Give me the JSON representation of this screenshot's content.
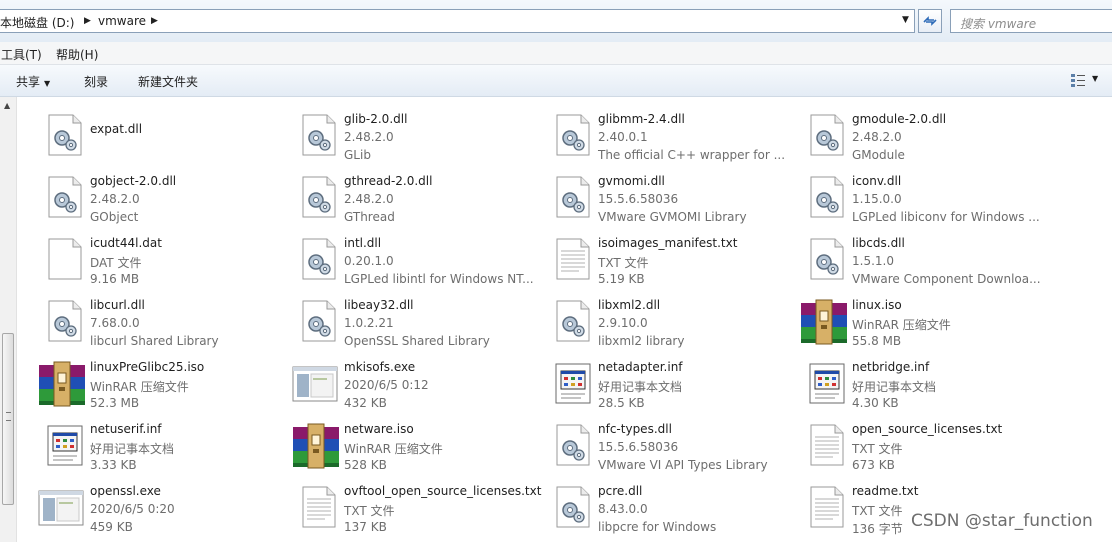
{
  "address": {
    "segments": [
      "本地磁盘 (D:)",
      "vmware"
    ],
    "search_placeholder": "搜索 vmware"
  },
  "menu": [
    "工具(T)",
    "帮助(H)"
  ],
  "commands": {
    "share": "共享",
    "burn": "刻录",
    "new_folder": "新建文件夹"
  },
  "files": [
    {
      "name": "expat.dll",
      "icon": "dll-icon",
      "line2": "",
      "line3": ""
    },
    {
      "name": "glib-2.0.dll",
      "icon": "dll-icon",
      "line2": "2.48.2.0",
      "line3": "GLib"
    },
    {
      "name": "glibmm-2.4.dll",
      "icon": "dll-icon",
      "line2": "2.40.0.1",
      "line3": "The official C++ wrapper for ..."
    },
    {
      "name": "gmodule-2.0.dll",
      "icon": "dll-icon",
      "line2": "2.48.2.0",
      "line3": "GModule"
    },
    {
      "name": "gobject-2.0.dll",
      "icon": "dll-icon",
      "line2": "2.48.2.0",
      "line3": "GObject"
    },
    {
      "name": "gthread-2.0.dll",
      "icon": "dll-icon",
      "line2": "2.48.2.0",
      "line3": "GThread"
    },
    {
      "name": "gvmomi.dll",
      "icon": "dll-icon",
      "line2": "15.5.6.58036",
      "line3": "VMware GVMOMI Library"
    },
    {
      "name": "iconv.dll",
      "icon": "dll-icon",
      "line2": "1.15.0.0",
      "line3": "LGPLed libiconv for Windows ..."
    },
    {
      "name": "icudt44l.dat",
      "icon": "blank-file-icon",
      "line2": "DAT 文件",
      "line3": "9.16 MB"
    },
    {
      "name": "intl.dll",
      "icon": "dll-icon",
      "line2": "0.20.1.0",
      "line3": "LGPLed libintl for Windows NT..."
    },
    {
      "name": "isoimages_manifest.txt",
      "icon": "text-file-icon",
      "line2": "TXT 文件",
      "line3": "5.19 KB"
    },
    {
      "name": "libcds.dll",
      "icon": "dll-icon",
      "line2": "1.5.1.0",
      "line3": "VMware Component Downloa..."
    },
    {
      "name": "libcurl.dll",
      "icon": "dll-icon",
      "line2": "7.68.0.0",
      "line3": "libcurl Shared Library"
    },
    {
      "name": "libeay32.dll",
      "icon": "dll-icon",
      "line2": "1.0.2.21",
      "line3": "OpenSSL Shared Library"
    },
    {
      "name": "libxml2.dll",
      "icon": "dll-icon",
      "line2": "2.9.10.0",
      "line3": "libxml2 library"
    },
    {
      "name": "linux.iso",
      "icon": "winrar-icon",
      "line2": "WinRAR 压缩文件",
      "line3": "55.8 MB"
    },
    {
      "name": "linuxPreGlibc25.iso",
      "icon": "winrar-icon",
      "line2": "WinRAR 压缩文件",
      "line3": "52.3 MB"
    },
    {
      "name": "mkisofs.exe",
      "icon": "exe-icon",
      "line2": "2020/6/5 0:12",
      "line3": "432 KB"
    },
    {
      "name": "netadapter.inf",
      "icon": "inf-icon",
      "line2": "好用记事本文档",
      "line3": "28.5 KB"
    },
    {
      "name": "netbridge.inf",
      "icon": "inf-icon",
      "line2": "好用记事本文档",
      "line3": "4.30 KB"
    },
    {
      "name": "netuserif.inf",
      "icon": "inf-icon",
      "line2": "好用记事本文档",
      "line3": "3.33 KB"
    },
    {
      "name": "netware.iso",
      "icon": "winrar-icon",
      "line2": "WinRAR 压缩文件",
      "line3": "528 KB"
    },
    {
      "name": "nfc-types.dll",
      "icon": "dll-icon",
      "line2": "15.5.6.58036",
      "line3": "VMware VI API Types Library"
    },
    {
      "name": "open_source_licenses.txt",
      "icon": "text-file-icon",
      "line2": "TXT 文件",
      "line3": "673 KB"
    },
    {
      "name": "openssl.exe",
      "icon": "exe-icon",
      "line2": "2020/6/5 0:20",
      "line3": "459 KB"
    },
    {
      "name": "ovftool_open_source_licenses.txt",
      "icon": "text-file-icon",
      "line2": "TXT 文件",
      "line3": "137 KB"
    },
    {
      "name": "pcre.dll",
      "icon": "dll-icon",
      "line2": "8.43.0.0",
      "line3": "libpcre for Windows"
    },
    {
      "name": "readme.txt",
      "icon": "text-file-icon",
      "line2": "TXT 文件",
      "line3": "136 字节"
    }
  ],
  "watermark": "CSDN @star_function",
  "colors": {
    "address_bg": "#e3ecf5",
    "toolbar_bg": "#e4ecf5",
    "text": "#1e1e1e",
    "secondary_text": "#6d6d6d"
  }
}
